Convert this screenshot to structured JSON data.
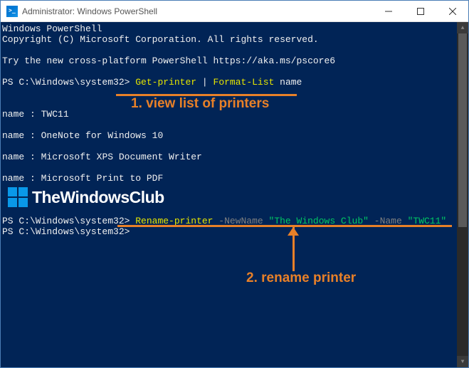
{
  "titlebar": {
    "title": "Administrator: Windows PowerShell"
  },
  "console": {
    "header1": "Windows PowerShell",
    "header2": "Copyright (C) Microsoft Corporation. All rights reserved.",
    "try_msg": "Try the new cross-platform PowerShell https://aka.ms/pscore6",
    "prompt": "PS C:\\Windows\\system32>",
    "cmd1_a": "Get-printer",
    "cmd1_b": "|",
    "cmd1_c": "Format-List",
    "cmd1_d": "name",
    "result_label": "name :",
    "printer1": "TWC11",
    "printer2": "OneNote for Windows 10",
    "printer3": "Microsoft XPS Document Writer",
    "printer4": "Microsoft Print to PDF",
    "cmd2_a": "Rename-printer",
    "cmd2_b": "-NewName",
    "cmd2_c": "\"The Windows Club\"",
    "cmd2_d": "-Name",
    "cmd2_e": "\"TWC11\""
  },
  "watermark": {
    "text": "TheWindowsClub"
  },
  "annotations": {
    "a1": "1. view list of printers",
    "a2": "2. rename printer"
  }
}
